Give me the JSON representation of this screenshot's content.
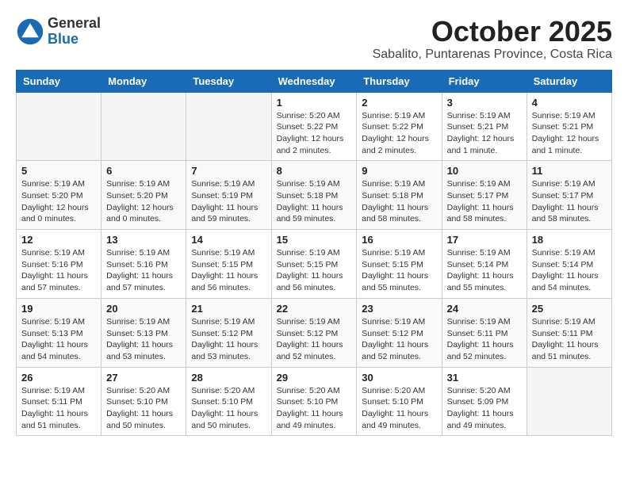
{
  "header": {
    "logo_general": "General",
    "logo_blue": "Blue",
    "month": "October 2025",
    "location": "Sabalito, Puntarenas Province, Costa Rica"
  },
  "weekdays": [
    "Sunday",
    "Monday",
    "Tuesday",
    "Wednesday",
    "Thursday",
    "Friday",
    "Saturday"
  ],
  "weeks": [
    [
      {
        "day": "",
        "info": ""
      },
      {
        "day": "",
        "info": ""
      },
      {
        "day": "",
        "info": ""
      },
      {
        "day": "1",
        "info": "Sunrise: 5:20 AM\nSunset: 5:22 PM\nDaylight: 12 hours\nand 2 minutes."
      },
      {
        "day": "2",
        "info": "Sunrise: 5:19 AM\nSunset: 5:22 PM\nDaylight: 12 hours\nand 2 minutes."
      },
      {
        "day": "3",
        "info": "Sunrise: 5:19 AM\nSunset: 5:21 PM\nDaylight: 12 hours\nand 1 minute."
      },
      {
        "day": "4",
        "info": "Sunrise: 5:19 AM\nSunset: 5:21 PM\nDaylight: 12 hours\nand 1 minute."
      }
    ],
    [
      {
        "day": "5",
        "info": "Sunrise: 5:19 AM\nSunset: 5:20 PM\nDaylight: 12 hours\nand 0 minutes."
      },
      {
        "day": "6",
        "info": "Sunrise: 5:19 AM\nSunset: 5:20 PM\nDaylight: 12 hours\nand 0 minutes."
      },
      {
        "day": "7",
        "info": "Sunrise: 5:19 AM\nSunset: 5:19 PM\nDaylight: 11 hours\nand 59 minutes."
      },
      {
        "day": "8",
        "info": "Sunrise: 5:19 AM\nSunset: 5:18 PM\nDaylight: 11 hours\nand 59 minutes."
      },
      {
        "day": "9",
        "info": "Sunrise: 5:19 AM\nSunset: 5:18 PM\nDaylight: 11 hours\nand 58 minutes."
      },
      {
        "day": "10",
        "info": "Sunrise: 5:19 AM\nSunset: 5:17 PM\nDaylight: 11 hours\nand 58 minutes."
      },
      {
        "day": "11",
        "info": "Sunrise: 5:19 AM\nSunset: 5:17 PM\nDaylight: 11 hours\nand 58 minutes."
      }
    ],
    [
      {
        "day": "12",
        "info": "Sunrise: 5:19 AM\nSunset: 5:16 PM\nDaylight: 11 hours\nand 57 minutes."
      },
      {
        "day": "13",
        "info": "Sunrise: 5:19 AM\nSunset: 5:16 PM\nDaylight: 11 hours\nand 57 minutes."
      },
      {
        "day": "14",
        "info": "Sunrise: 5:19 AM\nSunset: 5:15 PM\nDaylight: 11 hours\nand 56 minutes."
      },
      {
        "day": "15",
        "info": "Sunrise: 5:19 AM\nSunset: 5:15 PM\nDaylight: 11 hours\nand 56 minutes."
      },
      {
        "day": "16",
        "info": "Sunrise: 5:19 AM\nSunset: 5:15 PM\nDaylight: 11 hours\nand 55 minutes."
      },
      {
        "day": "17",
        "info": "Sunrise: 5:19 AM\nSunset: 5:14 PM\nDaylight: 11 hours\nand 55 minutes."
      },
      {
        "day": "18",
        "info": "Sunrise: 5:19 AM\nSunset: 5:14 PM\nDaylight: 11 hours\nand 54 minutes."
      }
    ],
    [
      {
        "day": "19",
        "info": "Sunrise: 5:19 AM\nSunset: 5:13 PM\nDaylight: 11 hours\nand 54 minutes."
      },
      {
        "day": "20",
        "info": "Sunrise: 5:19 AM\nSunset: 5:13 PM\nDaylight: 11 hours\nand 53 minutes."
      },
      {
        "day": "21",
        "info": "Sunrise: 5:19 AM\nSunset: 5:12 PM\nDaylight: 11 hours\nand 53 minutes."
      },
      {
        "day": "22",
        "info": "Sunrise: 5:19 AM\nSunset: 5:12 PM\nDaylight: 11 hours\nand 52 minutes."
      },
      {
        "day": "23",
        "info": "Sunrise: 5:19 AM\nSunset: 5:12 PM\nDaylight: 11 hours\nand 52 minutes."
      },
      {
        "day": "24",
        "info": "Sunrise: 5:19 AM\nSunset: 5:11 PM\nDaylight: 11 hours\nand 52 minutes."
      },
      {
        "day": "25",
        "info": "Sunrise: 5:19 AM\nSunset: 5:11 PM\nDaylight: 11 hours\nand 51 minutes."
      }
    ],
    [
      {
        "day": "26",
        "info": "Sunrise: 5:19 AM\nSunset: 5:11 PM\nDaylight: 11 hours\nand 51 minutes."
      },
      {
        "day": "27",
        "info": "Sunrise: 5:20 AM\nSunset: 5:10 PM\nDaylight: 11 hours\nand 50 minutes."
      },
      {
        "day": "28",
        "info": "Sunrise: 5:20 AM\nSunset: 5:10 PM\nDaylight: 11 hours\nand 50 minutes."
      },
      {
        "day": "29",
        "info": "Sunrise: 5:20 AM\nSunset: 5:10 PM\nDaylight: 11 hours\nand 49 minutes."
      },
      {
        "day": "30",
        "info": "Sunrise: 5:20 AM\nSunset: 5:10 PM\nDaylight: 11 hours\nand 49 minutes."
      },
      {
        "day": "31",
        "info": "Sunrise: 5:20 AM\nSunset: 5:09 PM\nDaylight: 11 hours\nand 49 minutes."
      },
      {
        "day": "",
        "info": ""
      }
    ]
  ]
}
